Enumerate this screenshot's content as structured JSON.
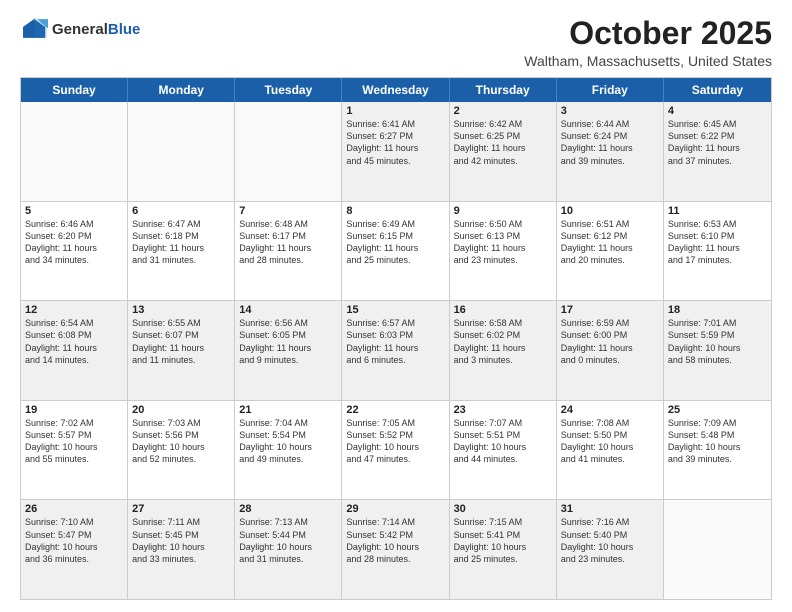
{
  "logo": {
    "general": "General",
    "blue": "Blue"
  },
  "title": "October 2025",
  "location": "Waltham, Massachusetts, United States",
  "days": [
    "Sunday",
    "Monday",
    "Tuesday",
    "Wednesday",
    "Thursday",
    "Friday",
    "Saturday"
  ],
  "weeks": [
    [
      {
        "day": "",
        "text": ""
      },
      {
        "day": "",
        "text": ""
      },
      {
        "day": "",
        "text": ""
      },
      {
        "day": "1",
        "text": "Sunrise: 6:41 AM\nSunset: 6:27 PM\nDaylight: 11 hours\nand 45 minutes."
      },
      {
        "day": "2",
        "text": "Sunrise: 6:42 AM\nSunset: 6:25 PM\nDaylight: 11 hours\nand 42 minutes."
      },
      {
        "day": "3",
        "text": "Sunrise: 6:44 AM\nSunset: 6:24 PM\nDaylight: 11 hours\nand 39 minutes."
      },
      {
        "day": "4",
        "text": "Sunrise: 6:45 AM\nSunset: 6:22 PM\nDaylight: 11 hours\nand 37 minutes."
      }
    ],
    [
      {
        "day": "5",
        "text": "Sunrise: 6:46 AM\nSunset: 6:20 PM\nDaylight: 11 hours\nand 34 minutes."
      },
      {
        "day": "6",
        "text": "Sunrise: 6:47 AM\nSunset: 6:18 PM\nDaylight: 11 hours\nand 31 minutes."
      },
      {
        "day": "7",
        "text": "Sunrise: 6:48 AM\nSunset: 6:17 PM\nDaylight: 11 hours\nand 28 minutes."
      },
      {
        "day": "8",
        "text": "Sunrise: 6:49 AM\nSunset: 6:15 PM\nDaylight: 11 hours\nand 25 minutes."
      },
      {
        "day": "9",
        "text": "Sunrise: 6:50 AM\nSunset: 6:13 PM\nDaylight: 11 hours\nand 23 minutes."
      },
      {
        "day": "10",
        "text": "Sunrise: 6:51 AM\nSunset: 6:12 PM\nDaylight: 11 hours\nand 20 minutes."
      },
      {
        "day": "11",
        "text": "Sunrise: 6:53 AM\nSunset: 6:10 PM\nDaylight: 11 hours\nand 17 minutes."
      }
    ],
    [
      {
        "day": "12",
        "text": "Sunrise: 6:54 AM\nSunset: 6:08 PM\nDaylight: 11 hours\nand 14 minutes."
      },
      {
        "day": "13",
        "text": "Sunrise: 6:55 AM\nSunset: 6:07 PM\nDaylight: 11 hours\nand 11 minutes."
      },
      {
        "day": "14",
        "text": "Sunrise: 6:56 AM\nSunset: 6:05 PM\nDaylight: 11 hours\nand 9 minutes."
      },
      {
        "day": "15",
        "text": "Sunrise: 6:57 AM\nSunset: 6:03 PM\nDaylight: 11 hours\nand 6 minutes."
      },
      {
        "day": "16",
        "text": "Sunrise: 6:58 AM\nSunset: 6:02 PM\nDaylight: 11 hours\nand 3 minutes."
      },
      {
        "day": "17",
        "text": "Sunrise: 6:59 AM\nSunset: 6:00 PM\nDaylight: 11 hours\nand 0 minutes."
      },
      {
        "day": "18",
        "text": "Sunrise: 7:01 AM\nSunset: 5:59 PM\nDaylight: 10 hours\nand 58 minutes."
      }
    ],
    [
      {
        "day": "19",
        "text": "Sunrise: 7:02 AM\nSunset: 5:57 PM\nDaylight: 10 hours\nand 55 minutes."
      },
      {
        "day": "20",
        "text": "Sunrise: 7:03 AM\nSunset: 5:56 PM\nDaylight: 10 hours\nand 52 minutes."
      },
      {
        "day": "21",
        "text": "Sunrise: 7:04 AM\nSunset: 5:54 PM\nDaylight: 10 hours\nand 49 minutes."
      },
      {
        "day": "22",
        "text": "Sunrise: 7:05 AM\nSunset: 5:52 PM\nDaylight: 10 hours\nand 47 minutes."
      },
      {
        "day": "23",
        "text": "Sunrise: 7:07 AM\nSunset: 5:51 PM\nDaylight: 10 hours\nand 44 minutes."
      },
      {
        "day": "24",
        "text": "Sunrise: 7:08 AM\nSunset: 5:50 PM\nDaylight: 10 hours\nand 41 minutes."
      },
      {
        "day": "25",
        "text": "Sunrise: 7:09 AM\nSunset: 5:48 PM\nDaylight: 10 hours\nand 39 minutes."
      }
    ],
    [
      {
        "day": "26",
        "text": "Sunrise: 7:10 AM\nSunset: 5:47 PM\nDaylight: 10 hours\nand 36 minutes."
      },
      {
        "day": "27",
        "text": "Sunrise: 7:11 AM\nSunset: 5:45 PM\nDaylight: 10 hours\nand 33 minutes."
      },
      {
        "day": "28",
        "text": "Sunrise: 7:13 AM\nSunset: 5:44 PM\nDaylight: 10 hours\nand 31 minutes."
      },
      {
        "day": "29",
        "text": "Sunrise: 7:14 AM\nSunset: 5:42 PM\nDaylight: 10 hours\nand 28 minutes."
      },
      {
        "day": "30",
        "text": "Sunrise: 7:15 AM\nSunset: 5:41 PM\nDaylight: 10 hours\nand 25 minutes."
      },
      {
        "day": "31",
        "text": "Sunrise: 7:16 AM\nSunset: 5:40 PM\nDaylight: 10 hours\nand 23 minutes."
      },
      {
        "day": "",
        "text": ""
      }
    ]
  ],
  "shaded_rows": [
    0,
    2,
    4
  ],
  "colors": {
    "header_bg": "#1a5fa8",
    "header_text": "#ffffff",
    "shaded_cell": "#f0f0f0",
    "empty_cell": "#f9f9f9"
  }
}
